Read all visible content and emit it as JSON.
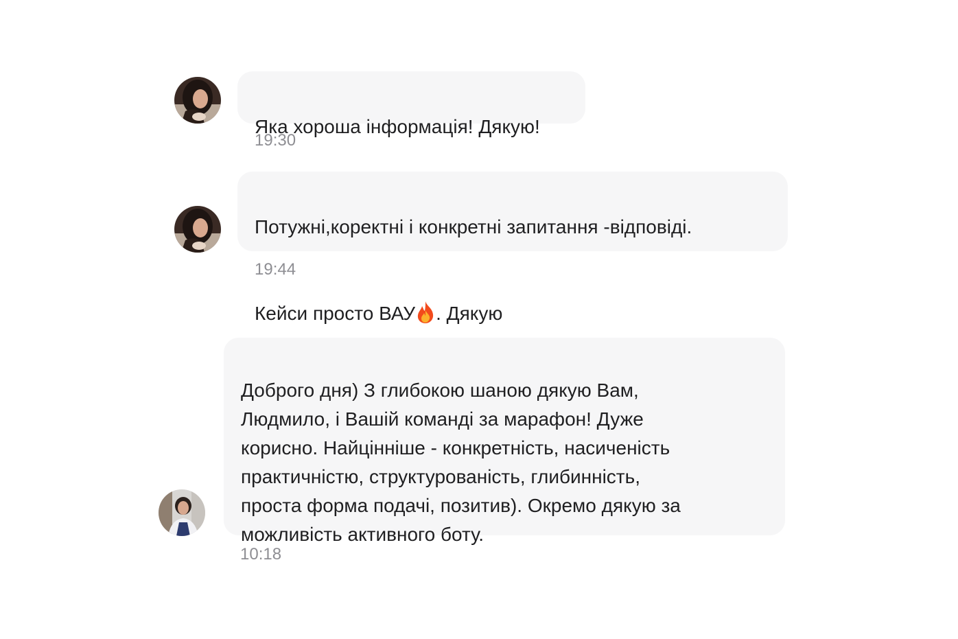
{
  "messages": [
    {
      "text": "Яка хороша інформація! Дякую!",
      "time": "19:30",
      "avatar": "woman-dark-hair-avatar"
    },
    {
      "text_line1": "Потужні,коректні і конкретні запитання -відповіді.",
      "text_line2_before": "Кейси просто ВАУ",
      "text_line2_after": ". Дякую",
      "emoji": "fire-icon",
      "time": "19:44",
      "avatar": "woman-dark-hair-avatar"
    },
    {
      "text": "Доброго дня) З глибокою шаною дякую Вам,\nЛюдмило, і Вашій команді за марафон! Дуже\nкорисно. Найцінніше - конкретність, насиченість\nпрактичністю, структурованість, глибинність,\nпроста форма подачі, позитив). Окремо дякую за\nможливість активного боту.",
      "time": "10:18",
      "avatar": "woman-light-background-avatar"
    }
  ],
  "colors": {
    "bubble": "#f6f6f7",
    "text": "#1f1f21",
    "timestamp": "#8e8e93",
    "background": "#ffffff"
  }
}
